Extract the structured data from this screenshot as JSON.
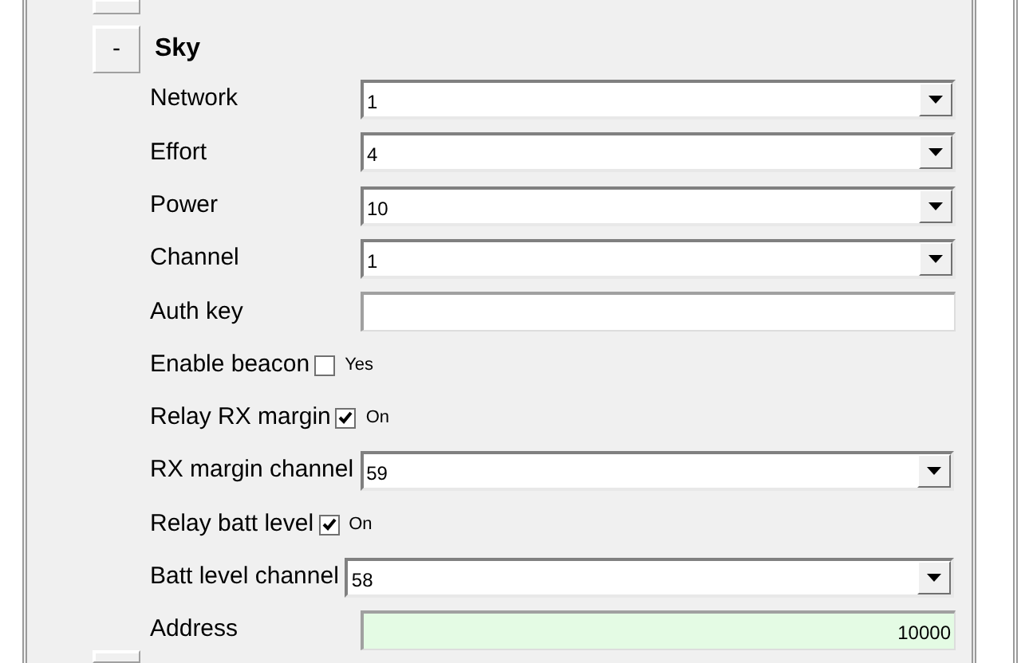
{
  "section": {
    "toggle": "-",
    "title": "Sky",
    "expanded": true
  },
  "fields": [
    {
      "kind": "combo",
      "label": "Network",
      "value": "1"
    },
    {
      "kind": "combo",
      "label": "Effort",
      "value": "4"
    },
    {
      "kind": "combo",
      "label": "Power",
      "value": "10"
    },
    {
      "kind": "combo",
      "label": "Channel",
      "value": "1"
    },
    {
      "kind": "text",
      "label": "Auth key",
      "highlighted": false
    },
    {
      "kind": "checkbox",
      "label": "Enable beacon",
      "checked": false,
      "caption": "Yes"
    },
    {
      "kind": "checkbox",
      "label": "Relay RX margin",
      "checked": true,
      "caption": "On"
    },
    {
      "kind": "inline-combo",
      "label": "RX margin channel",
      "value": "59"
    },
    {
      "kind": "checkbox",
      "label": "Relay batt level",
      "checked": true,
      "caption": "On"
    },
    {
      "kind": "inline-combo",
      "label": "Batt level channel",
      "value": "58"
    },
    {
      "kind": "text",
      "label": "Address",
      "value": "10000",
      "highlighted": true
    }
  ]
}
